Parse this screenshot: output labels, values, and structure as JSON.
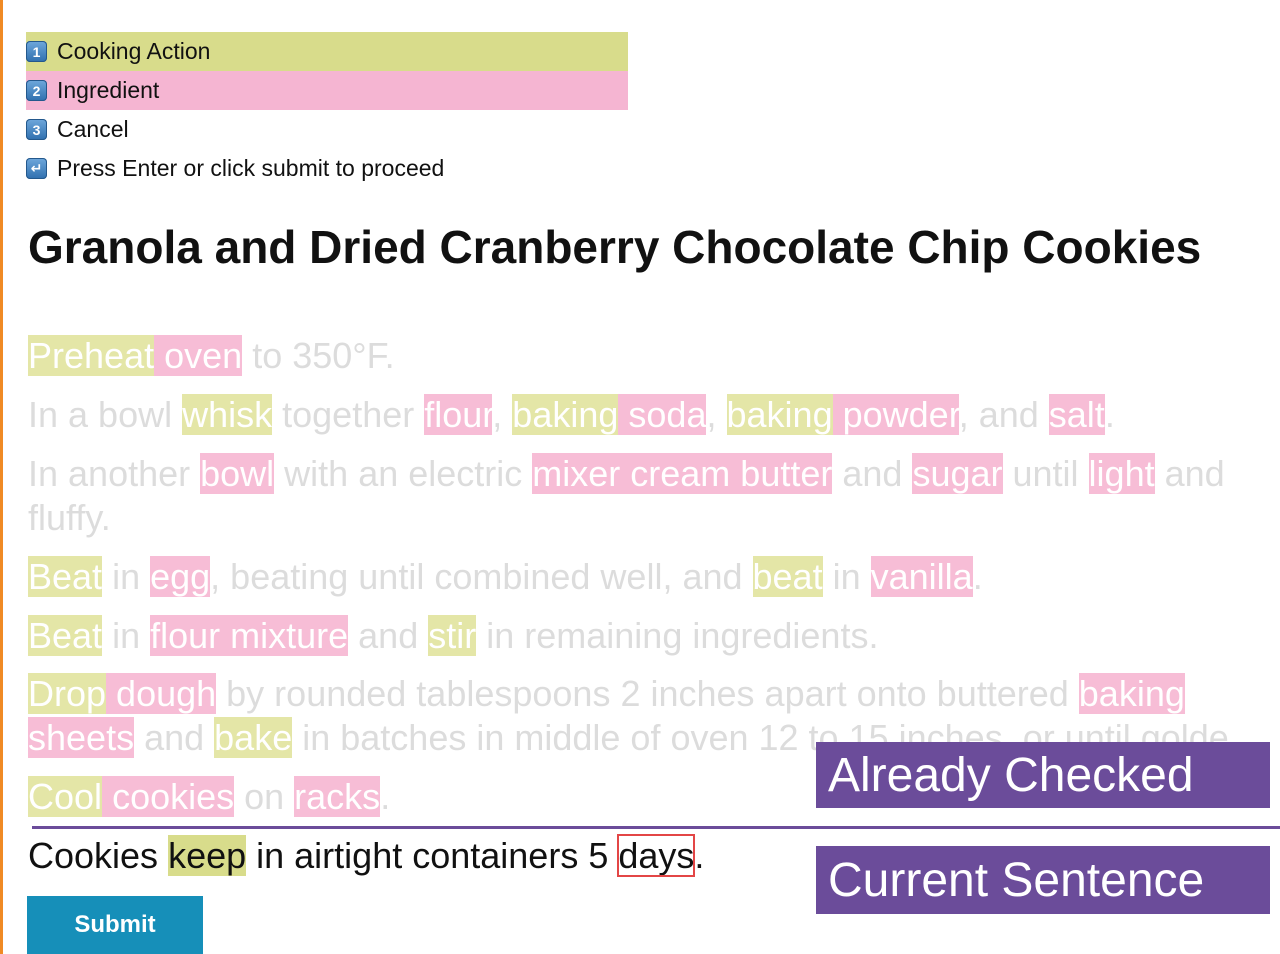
{
  "legend": {
    "items": [
      {
        "key": "1",
        "label": "Cooking Action"
      },
      {
        "key": "2",
        "label": "Ingredient"
      },
      {
        "key": "3",
        "label": "Cancel"
      },
      {
        "key": "↵",
        "label": "Press Enter or click submit to proceed"
      }
    ]
  },
  "recipe_title": "Granola and Dried Cranberry Chocolate Chip Cookies",
  "sentences": {
    "s1": [
      "Preheat",
      " ",
      "oven",
      " to 350°F."
    ],
    "s2": [
      "In a bowl ",
      "whisk",
      " together ",
      "flour",
      ", ",
      "baking",
      " ",
      "soda",
      ", ",
      "baking",
      " ",
      "powder",
      ", and ",
      "salt",
      "."
    ],
    "s3a": [
      "In another ",
      "bowl",
      " with an electric ",
      "mixer cream butter",
      " and ",
      "sugar",
      " until ",
      "light",
      " and"
    ],
    "s3b": [
      "fluffy."
    ],
    "s4": [
      "Beat",
      " in ",
      "egg",
      ", beating until combined well, and ",
      "beat",
      " in ",
      "vanilla",
      "."
    ],
    "s5": [
      "Beat",
      " in ",
      "flour mixture",
      " and ",
      "stir",
      " in remaining ingredients."
    ],
    "s6a": [
      "Drop",
      " ",
      "dough",
      " by rounded tablespoons 2 inches apart onto buttered ",
      "baking"
    ],
    "s6b": [
      "sheets",
      " and ",
      "bake",
      " in batches in middle of oven 12 to 15 inches, or until golde"
    ],
    "s7": [
      "Cool",
      " ",
      "cookies",
      " on ",
      "racks",
      "."
    ]
  },
  "current_sentence": {
    "pre": "Cookies ",
    "action": "keep",
    "mid": " in airtight containers 5 ",
    "selected": "days",
    "post": "."
  },
  "labels": {
    "already_checked": "Already Checked",
    "current_sentence": "Current Sentence"
  },
  "submit_label": "Submit",
  "colors": {
    "action": "#d8dc8b",
    "ingredient": "#f5b5d2",
    "label_bg": "#6b4c9a",
    "submit_bg": "#168fb9",
    "selection_box": "#e34646"
  }
}
